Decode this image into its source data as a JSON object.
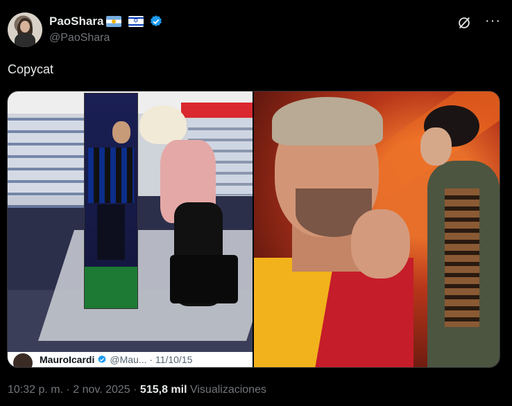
{
  "author": {
    "display_name": "PaoShara",
    "handle": "@PaoShara",
    "flags": [
      "flag-argentina-icon",
      "flag-israel-icon"
    ],
    "verified": true
  },
  "tweet": {
    "text": "Copycat"
  },
  "quoted_caption": {
    "name": "MauroIcardi",
    "handle": "@Mau... · 11/10/15"
  },
  "meta": {
    "time": "10:32 p. m.",
    "sep1": " · ",
    "date": "2 nov. 2025",
    "sep2": " · ",
    "views_count": "515,8 mil",
    "views_label": " Visualizaciones"
  },
  "colors": {
    "background": "#000000",
    "text": "#e7e9ea",
    "muted": "#71767b",
    "verified_blue": "#1d9bf0",
    "border": "#2f3336"
  },
  "icons": {
    "grok": "grok-icon",
    "more": "more-icon",
    "verified": "verified-badge-icon"
  }
}
